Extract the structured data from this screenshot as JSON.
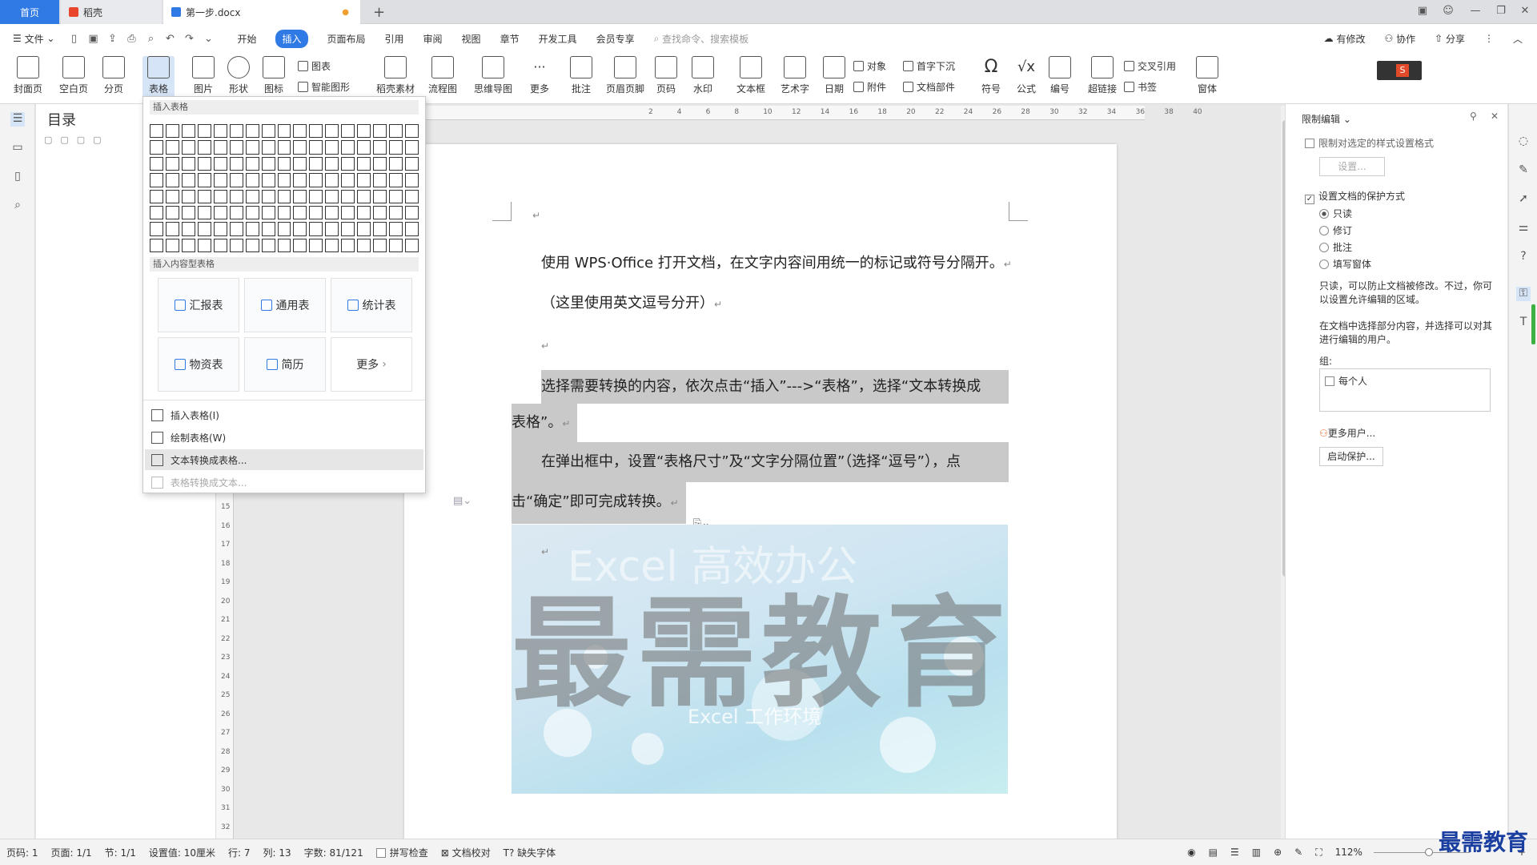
{
  "tabs": {
    "home": "首页",
    "daoke": "稻壳",
    "doc": "第一步.docx",
    "plus": "+"
  },
  "menu": {
    "file": "文件",
    "items": [
      "开始",
      "插入",
      "页面布局",
      "引用",
      "审阅",
      "视图",
      "章节",
      "开发工具",
      "会员专享"
    ],
    "active": "插入",
    "search_placeholder": "查找命令、搜索模板",
    "right": [
      "有修改",
      "协作",
      "分享"
    ]
  },
  "ribbon": {
    "big": [
      "封面页",
      "空白页",
      "分页",
      "表格",
      "图片",
      "形状",
      "图标",
      "稻壳素材",
      "流程图",
      "思维导图",
      "更多",
      "批注",
      "页眉页脚",
      "页码",
      "水印",
      "文本框",
      "艺术字",
      "日期",
      "符号",
      "公式",
      "编号",
      "超链接",
      "窗体"
    ],
    "small": [
      "图表",
      "智能图形",
      "对象",
      "附件",
      "首字下沉",
      "文档部件",
      "交叉引用",
      "书签"
    ]
  },
  "nav": {
    "title": "目录"
  },
  "dropdown": {
    "section_insert": "插入表格",
    "section_templates": "插入内容型表格",
    "templates": [
      "汇报表",
      "通用表",
      "统计表",
      "物资表",
      "简历",
      "更多"
    ],
    "items": [
      "插入表格(I)",
      "绘制表格(W)",
      "文本转换成表格...",
      "表格转换成文本..."
    ]
  },
  "document": {
    "line1": "使用 WPS·Office 打开文档，在文字内容间用统一的标记或符号分隔开。",
    "line2": "（这里使用英文逗号分开）",
    "line3a": "选择需要转换的内容，依次点击“插入”--->“表格”，选择“文本转换成",
    "line3b": "表格”。",
    "line4a": "在弹出框中，设置“表格尺寸”及“文字分隔位置”（选择“逗号”），点",
    "line4b": "击“确定”即可完成转换。",
    "para_mark": "↵",
    "image": {
      "watermark": "最需教育",
      "top_text": "Excel 高效办公",
      "sub_text": "Excel 工作环境"
    }
  },
  "right_panel": {
    "title": "限制编辑",
    "opt1": "限制对选定的样式设置格式",
    "settings_btn": "设置...",
    "opt2": "设置文档的保护方式",
    "radios": [
      "只读",
      "修订",
      "批注",
      "填写窗体"
    ],
    "desc1a": "只读，可以防止文档被修改。不过，你可",
    "desc1b": "以设置允许编辑的区域。",
    "desc2a": "在文档中选择部分内容，并选择可以对其",
    "desc2b": "进行编辑的用户。",
    "group_label": "组:",
    "everyone": "每个人",
    "more_users": "更多用户...",
    "start_btn": "启动保护..."
  },
  "status": {
    "items": [
      "页码: 1",
      "页面: 1/1",
      "节: 1/1",
      "设置值: 10厘米",
      "行: 7",
      "列: 13",
      "字数: 81/121",
      "拼写检查",
      "文档校对",
      "缺失字体"
    ],
    "zoom": "112%"
  },
  "brand": "最需教育",
  "ruler_h": [
    "2",
    "4",
    "6",
    "8",
    "10",
    "12",
    "14",
    "16",
    "18",
    "20",
    "22",
    "24",
    "26",
    "28",
    "30",
    "32",
    "34",
    "36",
    "38",
    "40"
  ],
  "ruler_v": [
    "15",
    "16",
    "17",
    "18",
    "19",
    "20",
    "21",
    "22",
    "23",
    "24",
    "25",
    "26",
    "27",
    "28",
    "29",
    "30",
    "31",
    "32"
  ],
  "colors": {
    "accent": "#2f7ae5",
    "highlight": "#c9c9c9"
  }
}
